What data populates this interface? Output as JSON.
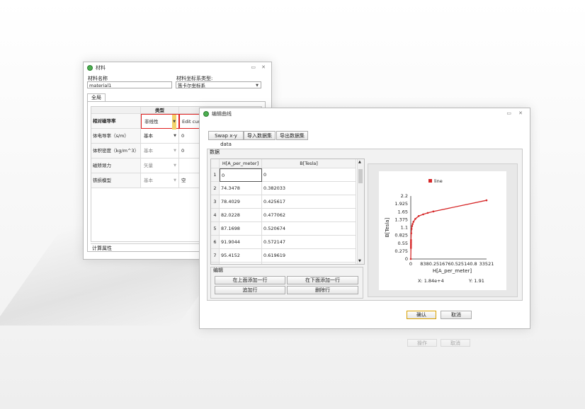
{
  "material_window": {
    "title": "材料",
    "name_label": "材料名称",
    "name_value": "material1",
    "coord_label": "材料坐标系类型:",
    "coord_value": "笛卡尔坐标系",
    "tab": "全局",
    "type_header": "类型",
    "rows": [
      {
        "label": "相对磁导率",
        "type": "非线性",
        "value": "Edit curve"
      },
      {
        "label": "体电导率（s/m）",
        "type": "基本",
        "value": "0"
      },
      {
        "label": "体积密度（kg/m^3）",
        "type": "基本",
        "value": "0"
      },
      {
        "label": "磁矫顽力",
        "type": "矢量",
        "value": ""
      },
      {
        "label": "铁损模型",
        "type": "基本",
        "value": "空"
      }
    ],
    "footer": "计算属性",
    "bottom_buttons": [
      "操作",
      "取消"
    ]
  },
  "curve_window": {
    "title": "编辑曲线",
    "toolbar": [
      "Swap x-y data",
      "导入数据集",
      "导出数据集"
    ],
    "data_group": "数据",
    "columns": [
      "H[A_per_meter]",
      "B[Tesla]"
    ],
    "rows": [
      [
        "1",
        "0",
        "0"
      ],
      [
        "2",
        "74.3478",
        "0.382033"
      ],
      [
        "3",
        "78.4029",
        "0.425617"
      ],
      [
        "4",
        "82.0228",
        "0.477062"
      ],
      [
        "5",
        "87.1698",
        "0.520674"
      ],
      [
        "6",
        "91.9044",
        "0.572147"
      ],
      [
        "7",
        "95.4152",
        "0.619619"
      ],
      [
        "8",
        "100.608",
        "0.667148"
      ]
    ],
    "edit_group": "编辑",
    "edit_buttons": [
      "在上面添加一行",
      "在下面添加一行",
      "追加行",
      "删除行"
    ],
    "ok": "确认",
    "cancel": "取消"
  },
  "chart_data": {
    "type": "line",
    "legend": "line",
    "legend_position": "top",
    "xlabel": "H[A_per_meter]",
    "ylabel": "B[Tesla]",
    "xlim": [
      0,
      33521
    ],
    "ylim": [
      0,
      2.2
    ],
    "xticks": [
      "0",
      "8380.25",
      "16760.5",
      "25140.8",
      "33521"
    ],
    "yticks": [
      "0",
      "0.275",
      "0.55",
      "0.825",
      "1.1",
      "1.375",
      "1.65",
      "1.925",
      "2.2"
    ],
    "series": [
      {
        "color": "#d62728",
        "x": [
          0,
          74.3478,
          78.4029,
          82.0228,
          87.1698,
          91.9044,
          95.4152,
          100.608,
          200,
          350,
          550,
          800,
          1200,
          2000,
          3500,
          5500,
          7500,
          10000,
          33521
        ],
        "y": [
          0,
          0.382033,
          0.425617,
          0.477062,
          0.520674,
          0.572147,
          0.619619,
          0.667148,
          0.9,
          1.05,
          1.15,
          1.22,
          1.3,
          1.4,
          1.5,
          1.56,
          1.61,
          1.66,
          2.05
        ]
      }
    ],
    "readout": {
      "x": "X: 1.84e+4",
      "y": "Y: 1.91"
    }
  }
}
